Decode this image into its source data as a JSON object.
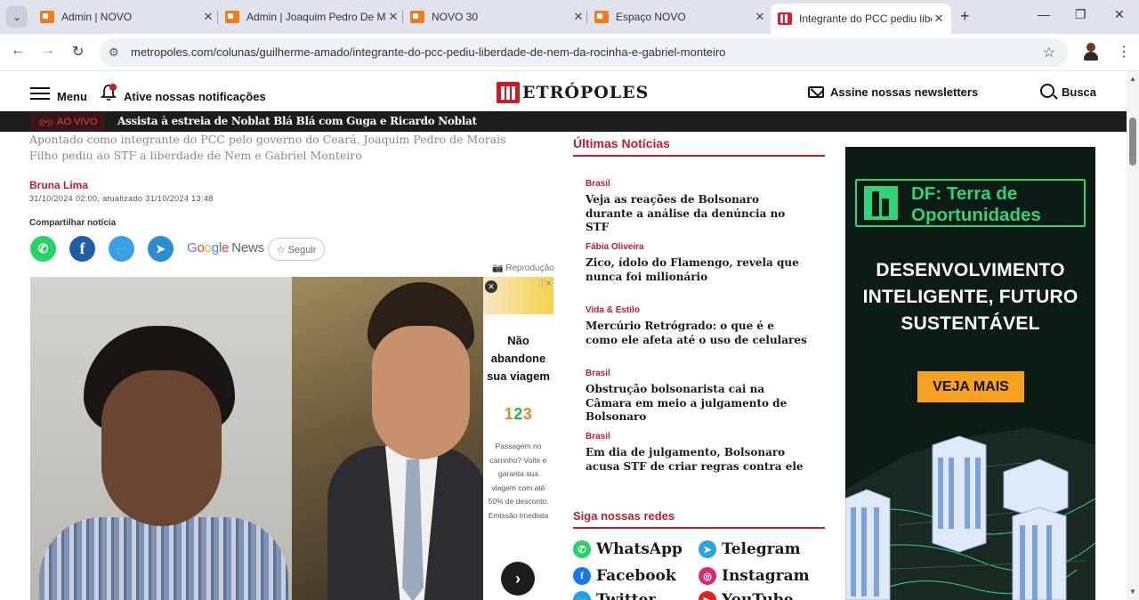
{
  "browser": {
    "tabs": [
      {
        "title": "Admin | NOVO",
        "active": false
      },
      {
        "title": "Admin | Joaquim Pedro De M",
        "active": false
      },
      {
        "title": "NOVO 30",
        "active": false
      },
      {
        "title": "Espaço NOVO",
        "active": false
      },
      {
        "title": "Integrante do PCC pediu libe",
        "active": true
      }
    ],
    "url": "metropoles.com/colunas/guilherme-amado/integrante-do-pcc-pediu-liberdade-de-nem-da-rocinha-e-gabriel-monteiro",
    "icons": {
      "back": "←",
      "forward": "→",
      "reload": "↻",
      "tune": "⚙",
      "star": "☆",
      "kebab": "⋮",
      "new_tab": "+",
      "minimize": "—",
      "restore": "❐",
      "close": "✕",
      "tab_close": "✕",
      "tab_menu": "⌄"
    }
  },
  "header": {
    "menu_label": "Menu",
    "notifications_label": "Ative nossas notificações",
    "logo_text": "ETRÓPOLES",
    "newsletter_label": "Assine nossas newsletters",
    "search_label": "Busca"
  },
  "live": {
    "badge": "AO VIVO",
    "badge_icon": "((•))",
    "text": "Assista à estreia de Noblat Blá Blá com Guga e Ricardo Noblat"
  },
  "article": {
    "subtitle": "Apontado como integrante do PCC pelo governo do Ceará, Joaquim Pedro de Morais Filho pediu ao STF a liberdade de Nem e Gabriel Monteiro",
    "author": "Bruna Lima",
    "dates": "31/10/2024 02:00, atualizado 31/10/2024 13:48",
    "share_label": "Compartilhar notícia",
    "google_news": {
      "g": "G",
      "o1": "o",
      "o2": "o",
      "g2": "g",
      "l": "l",
      "e": "e",
      "news": "News"
    },
    "follow_label": "☆ Seguir",
    "photo_credit": "📷 Reprodução",
    "share_icons": {
      "whatsapp": "✆",
      "facebook": "f",
      "twitter": "🐦",
      "telegram": "➤"
    }
  },
  "inline_ad": {
    "headline": "Não abandone sua viagem",
    "brand": [
      "1",
      "2",
      "3"
    ],
    "body": "Passagem no carrinho? Volte e garanta sua viagem com até 50% de desconto. Emissão Imediata",
    "close": "✕",
    "info": "ⓘ✕",
    "next": "›"
  },
  "latest": {
    "title": "Últimas Notícias",
    "items": [
      {
        "category": "Brasil",
        "headline": "Veja as reações de Bolsonaro durante a análise da denúncia no STF"
      },
      {
        "category": "Fábia Oliveira",
        "headline": "Zico, ídolo do Flamengo, revela que nunca foi milionário"
      },
      {
        "category": "Vida & Estilo",
        "headline": "Mercúrio Retrógrado: o que é e como ele afeta até o uso de celulares"
      },
      {
        "category": "Brasil",
        "headline": "Obstrução bolsonarista cai na Câmara em meio a julgamento de Bolsonaro"
      },
      {
        "category": "Brasil",
        "headline": "Em dia de julgamento, Bolsonaro acusa STF de criar regras contra ele"
      }
    ]
  },
  "social": {
    "title": "Siga nossas redes",
    "networks": [
      {
        "name": "WhatsApp",
        "icon": "✆",
        "color": "#25d366"
      },
      {
        "name": "Telegram",
        "icon": "➤",
        "color": "#2aa3df"
      },
      {
        "name": "Facebook",
        "icon": "f",
        "color": "#1877f2"
      },
      {
        "name": "Instagram",
        "icon": "◎",
        "color": "#d62976"
      },
      {
        "name": "Twitter",
        "icon": "🐦",
        "color": "#1da1f2"
      },
      {
        "name": "YouTube",
        "icon": "▶",
        "color": "#e62117"
      }
    ]
  },
  "big_ad": {
    "brand": "DF: Terra de Oportunidades",
    "main": "DESENVOLVIMENTO INTELIGENTE, FUTURO SUSTENTÁVEL",
    "button": "VEJA MAIS"
  },
  "colors": {
    "accent_red": "#c21d25",
    "ad_green": "#2fd37a",
    "ad_orange": "#f6a21e"
  }
}
